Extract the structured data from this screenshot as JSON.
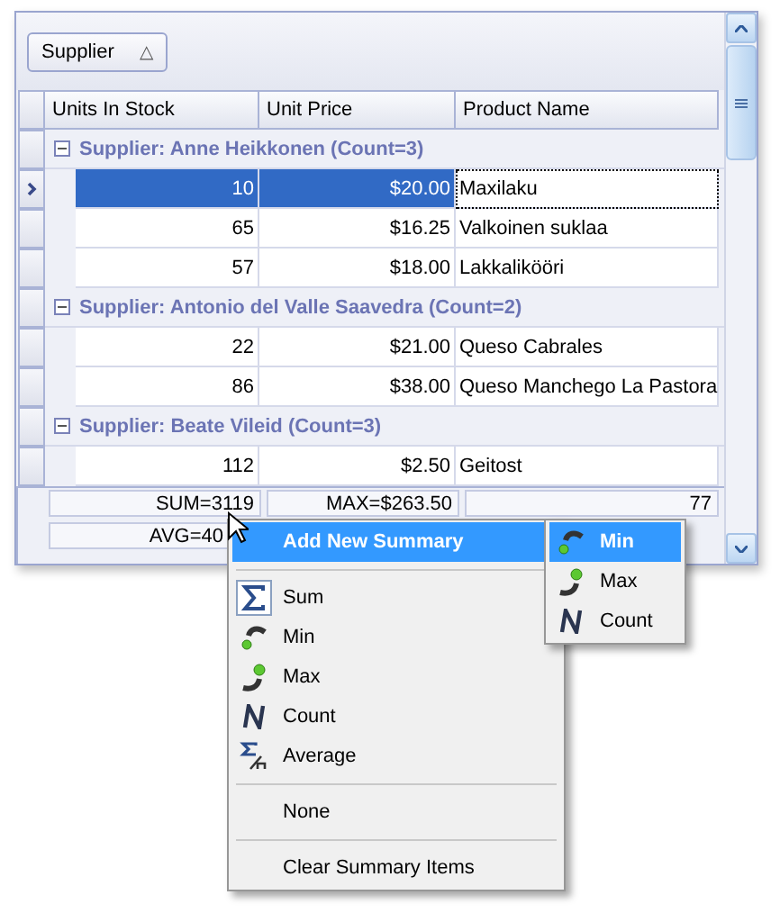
{
  "group_panel": {
    "chips": [
      {
        "label": "Supplier",
        "sort_glyph": "△"
      }
    ]
  },
  "columns": [
    "Units In Stock",
    "Unit Price",
    "Product Name"
  ],
  "rows": [
    {
      "kind": "group",
      "label": "Supplier: Anne Heikkonen (Count=3)",
      "expanded": true
    },
    {
      "kind": "data",
      "selected": true,
      "focused": true,
      "cells": [
        "10",
        "$20.00",
        "Maxilaku"
      ]
    },
    {
      "kind": "data",
      "selected": false,
      "focused": false,
      "cells": [
        "65",
        "$16.25",
        "Valkoinen suklaa"
      ]
    },
    {
      "kind": "data",
      "selected": false,
      "focused": false,
      "cells": [
        "57",
        "$18.00",
        "Lakkalikööri"
      ]
    },
    {
      "kind": "group",
      "label": "Supplier: Antonio del Valle Saavedra  (Count=2)",
      "expanded": true
    },
    {
      "kind": "data",
      "selected": false,
      "focused": false,
      "cells": [
        "22",
        "$21.00",
        "Queso Cabrales"
      ]
    },
    {
      "kind": "data",
      "selected": false,
      "focused": false,
      "cells": [
        "86",
        "$38.00",
        "Queso Manchego La Pastora"
      ]
    },
    {
      "kind": "group",
      "label": "Supplier: Beate Vileid (Count=3)",
      "expanded": true
    },
    {
      "kind": "data",
      "selected": false,
      "focused": false,
      "cells": [
        "112",
        "$2.50",
        "Geitost"
      ]
    }
  ],
  "footer": [
    [
      "SUM=3119",
      "MAX=$263.50",
      "77"
    ],
    [
      "AVG=40"
    ]
  ],
  "context_menu": {
    "sections": [
      [
        {
          "label": "Add New Summary",
          "kind": "plain",
          "selected": true,
          "checked": false,
          "submenu": true
        }
      ],
      [
        {
          "label": "Sum",
          "kind": "sum",
          "selected": false,
          "checked": true,
          "submenu": false
        },
        {
          "label": "Min",
          "kind": "min",
          "selected": false,
          "checked": false,
          "submenu": false
        },
        {
          "label": "Max",
          "kind": "max",
          "selected": false,
          "checked": false,
          "submenu": false
        },
        {
          "label": "Count",
          "kind": "count",
          "selected": false,
          "checked": false,
          "submenu": false
        },
        {
          "label": "Average",
          "kind": "average",
          "selected": false,
          "checked": false,
          "submenu": false
        }
      ],
      [
        {
          "label": "None",
          "kind": "plain",
          "selected": false,
          "checked": false,
          "submenu": false
        }
      ],
      [
        {
          "label": "Clear Summary Items",
          "kind": "plain",
          "selected": false,
          "checked": false,
          "submenu": false
        }
      ]
    ]
  },
  "submenu": {
    "items": [
      {
        "label": "Min",
        "kind": "min",
        "selected": true
      },
      {
        "label": "Max",
        "kind": "max",
        "selected": false
      },
      {
        "label": "Count",
        "kind": "count",
        "selected": false
      }
    ]
  }
}
